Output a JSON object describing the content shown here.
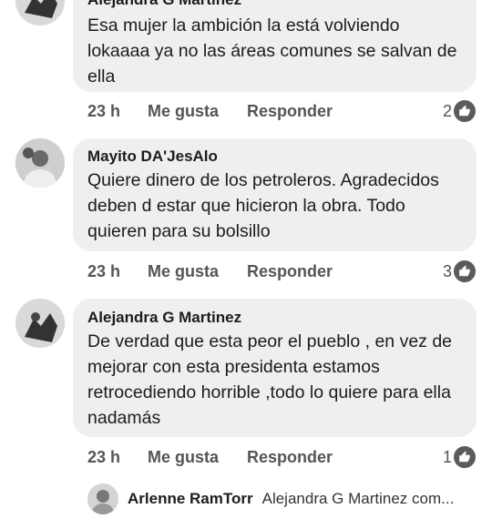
{
  "comments": [
    {
      "author": "Alejandra G Martinez",
      "text": "Esa mujer la ambición la está volviendo lokaaaa  ya no las áreas comunes se salvan de ella",
      "time": "23 h",
      "like_label": "Me gusta",
      "reply_label": "Responder",
      "reactions": "2"
    },
    {
      "author": "Mayito DA'JesAlo",
      "text": "Quiere dinero de los petroleros. Agradecidos deben d estar que hicieron la obra. Todo quieren para su bolsillo",
      "time": "23 h",
      "like_label": "Me gusta",
      "reply_label": "Responder",
      "reactions": "3"
    },
    {
      "author": "Alejandra G Martinez",
      "text": "De verdad que esta peor el pueblo , en vez de mejorar con esta presidenta estamos retrocediendo horrible ,todo lo quiere para ella nadamás",
      "time": "23 h",
      "like_label": "Me gusta",
      "reply_label": "Responder",
      "reactions": "1"
    }
  ],
  "reply_preview": {
    "author": "Arlenne RamTorr",
    "text": "Alejandra G Martinez com..."
  },
  "icons": {
    "reaction": "thumbs-up-icon"
  },
  "colors": {
    "bubble": "#efefef",
    "meta_text": "#555555",
    "reaction_badge": "#5b5b5b"
  }
}
